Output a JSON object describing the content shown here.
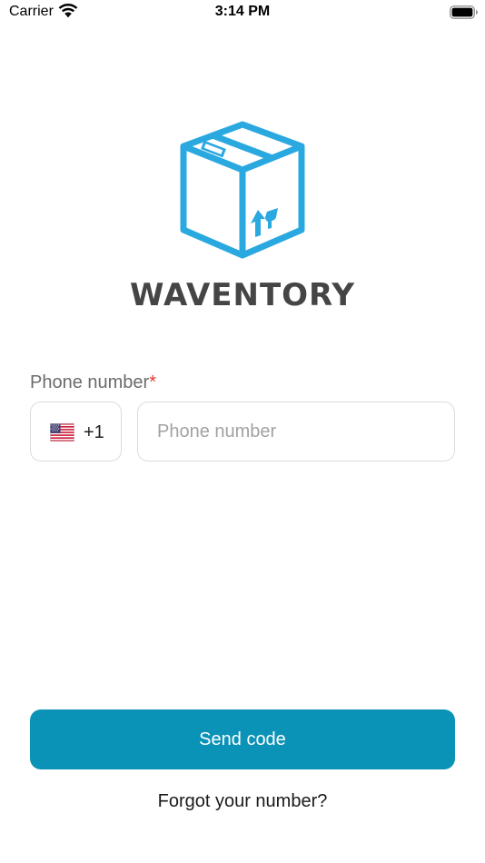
{
  "status_bar": {
    "carrier": "Carrier",
    "time": "3:14 PM",
    "wifi_icon": "wifi-icon",
    "battery_icon": "battery-icon"
  },
  "logo": {
    "icon": "box-icon",
    "wordmark": "WAVENTORY",
    "brand_color": "#2aa8e0",
    "wordmark_color": "#454545"
  },
  "phone_field": {
    "label": "Phone number",
    "required_marker": "*",
    "country_flag": "us-flag-icon",
    "dial_code": "+1",
    "value": "",
    "placeholder": "Phone number"
  },
  "actions": {
    "send_label": "Send code",
    "send_color": "#0b93b7",
    "forgot_label": "Forgot your number?"
  }
}
